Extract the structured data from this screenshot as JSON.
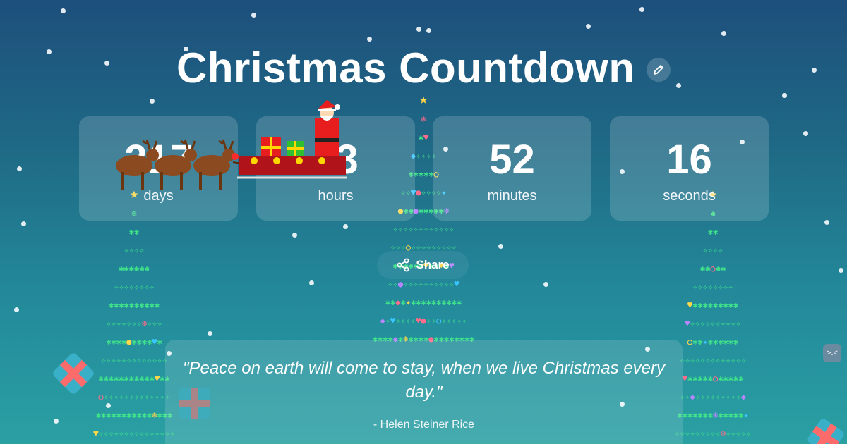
{
  "page": {
    "title": "Christmas Countdown"
  },
  "countdown": [
    {
      "value": "217",
      "label": "days"
    },
    {
      "value": "13",
      "label": "hours"
    },
    {
      "value": "52",
      "label": "minutes"
    },
    {
      "value": "16",
      "label": "seconds"
    }
  ],
  "share": {
    "label": "Share"
  },
  "quote": {
    "text": "\"Peace on earth will come to stay, when we live Christmas every day.\"",
    "author": "- Helen Steiner Rice"
  },
  "icons": {
    "edit": "pencil-icon",
    "share": "share-icon",
    "side": "face-icon"
  },
  "side_badge": {
    "text": ">.<"
  },
  "colors": {
    "bg_top": "#1d4f7c",
    "bg_bottom": "#2aa0a3",
    "tree": "#3fe08b",
    "star": "#ffd84a"
  }
}
